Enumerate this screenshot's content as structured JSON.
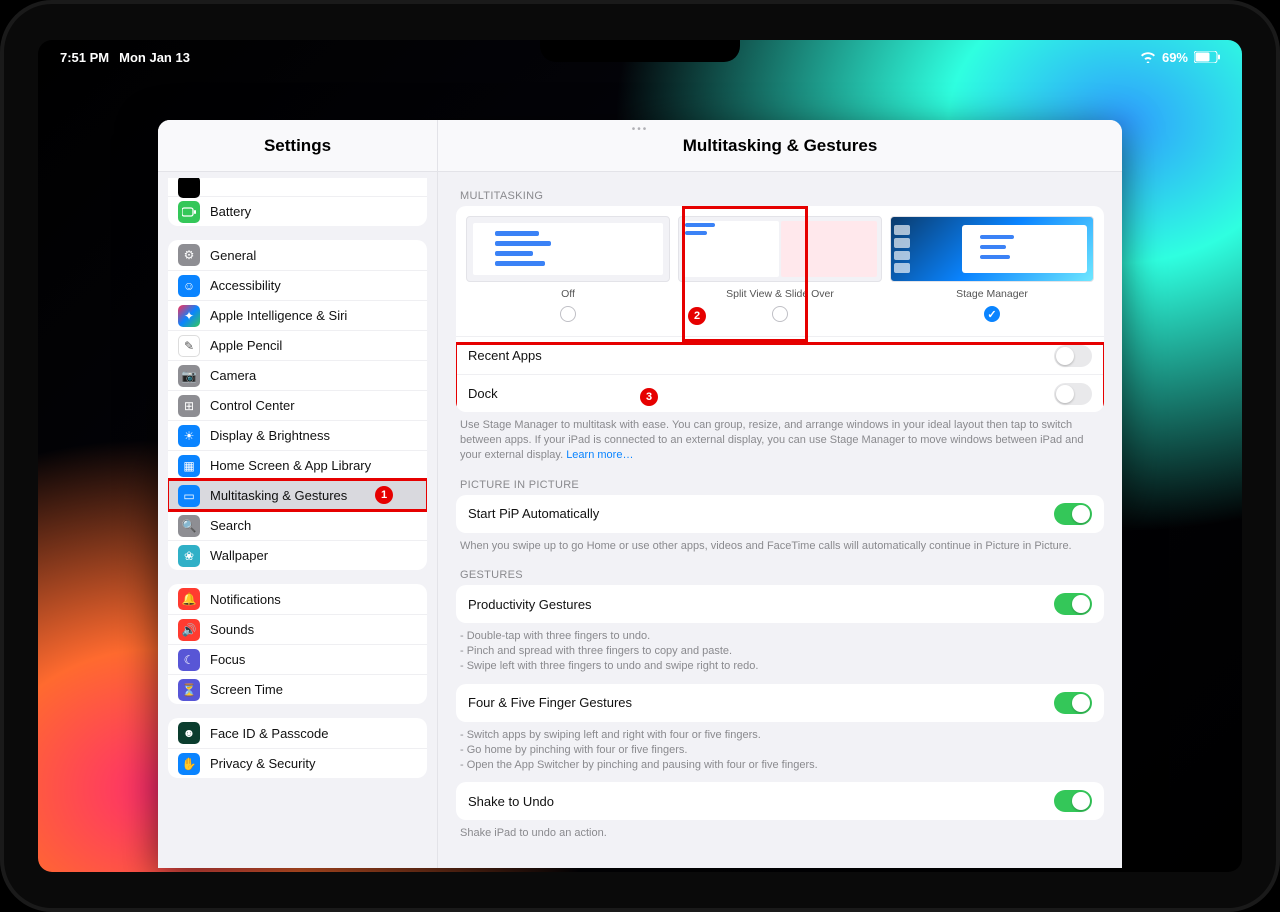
{
  "status": {
    "time": "7:51 PM",
    "date": "Mon Jan 13",
    "battery": "69%"
  },
  "sidebar": {
    "title": "Settings",
    "group1": [
      {
        "label": "Battery"
      }
    ],
    "group2": [
      {
        "label": "General"
      },
      {
        "label": "Accessibility"
      },
      {
        "label": "Apple Intelligence & Siri"
      },
      {
        "label": "Apple Pencil"
      },
      {
        "label": "Camera"
      },
      {
        "label": "Control Center"
      },
      {
        "label": "Display & Brightness"
      },
      {
        "label": "Home Screen & App Library"
      },
      {
        "label": "Multitasking & Gestures"
      },
      {
        "label": "Search"
      },
      {
        "label": "Wallpaper"
      }
    ],
    "group3": [
      {
        "label": "Notifications"
      },
      {
        "label": "Sounds"
      },
      {
        "label": "Focus"
      },
      {
        "label": "Screen Time"
      }
    ],
    "group4": [
      {
        "label": "Face ID & Passcode"
      },
      {
        "label": "Privacy & Security"
      }
    ]
  },
  "main": {
    "title": "Multitasking & Gestures",
    "multitasking": {
      "heading": "MULTITASKING",
      "options": [
        {
          "label": "Off"
        },
        {
          "label": "Split View & Slide Over"
        },
        {
          "label": "Stage Manager"
        }
      ],
      "recent_apps": "Recent Apps",
      "dock": "Dock",
      "footnote": "Use Stage Manager to multitask with ease. You can group, resize, and arrange windows in your ideal layout then tap to switch between apps. If your iPad is connected to an external display, you can use Stage Manager to move windows between iPad and your external display.",
      "learn_more": "Learn more…"
    },
    "pip": {
      "heading": "PICTURE IN PICTURE",
      "row": "Start PiP Automatically",
      "footnote": "When you swipe up to go Home or use other apps, videos and FaceTime calls will automatically continue in Picture in Picture."
    },
    "gestures": {
      "heading": "GESTURES",
      "productivity": "Productivity Gestures",
      "productivity_foot": "- Double-tap with three fingers to undo.\n- Pinch and spread with three fingers to copy and paste.\n- Swipe left with three fingers to undo and swipe right to redo.",
      "fourfive": "Four & Five Finger Gestures",
      "fourfive_foot": "- Switch apps by swiping left and right with four or five fingers.\n- Go home by pinching with four or five fingers.\n- Open the App Switcher by pinching and pausing with four or five fingers.",
      "shake": "Shake to Undo",
      "shake_foot": "Shake iPad to undo an action."
    }
  },
  "annotations": {
    "b1": "1",
    "b2": "2",
    "b3": "3"
  }
}
